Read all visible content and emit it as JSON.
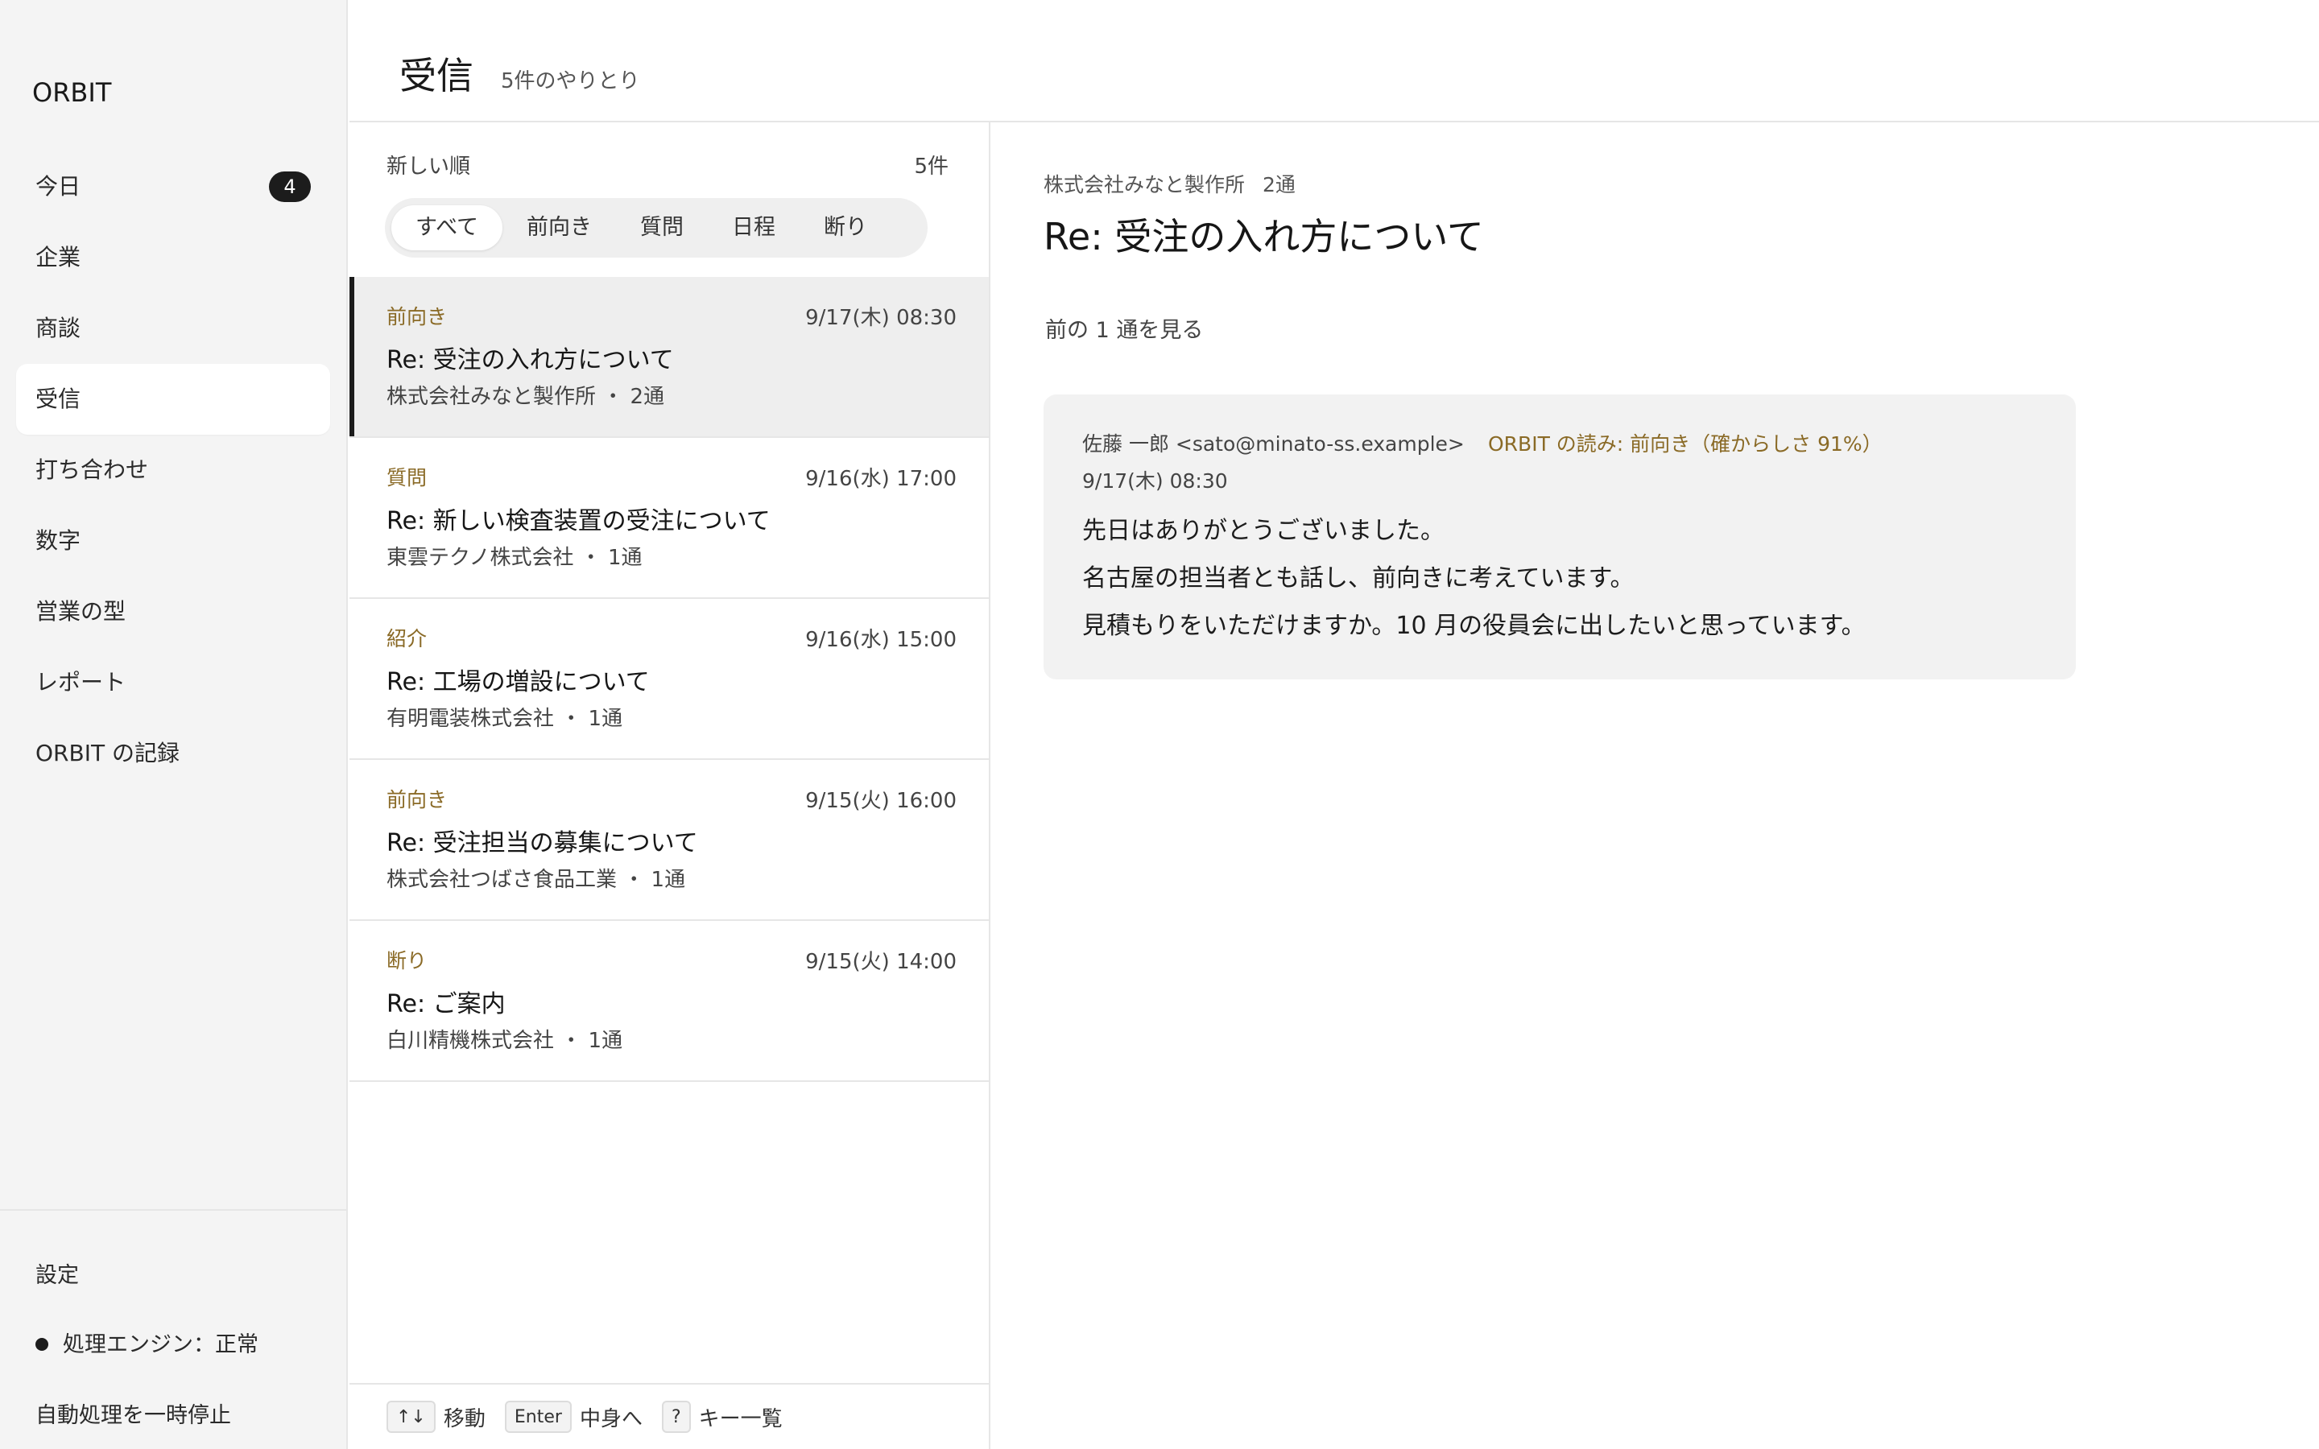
{
  "app": {
    "brand": "ORBIT"
  },
  "sidebar": {
    "items": [
      {
        "label": "今日",
        "badge": "4"
      },
      {
        "label": "企業"
      },
      {
        "label": "商談"
      },
      {
        "label": "受信",
        "active": true
      },
      {
        "label": "打ち合わせ"
      },
      {
        "label": "数字"
      },
      {
        "label": "営業の型"
      },
      {
        "label": "レポート"
      },
      {
        "label": "ORBIT の記録"
      }
    ],
    "settings": "設定",
    "engine_status": "処理エンジン：正常",
    "pause": "自動処理を一時停止"
  },
  "header": {
    "title": "受信",
    "subtitle": "5件のやりとり"
  },
  "list": {
    "sort": "新しい順",
    "count": "5件",
    "filters": [
      "すべて",
      "前向き",
      "質問",
      "日程",
      "断り"
    ],
    "active_filter": "すべて",
    "messages": [
      {
        "tag": "前向き",
        "date": "9/17(木) 08:30",
        "subject": "Re: 受注の入れ方について",
        "sender": "株式会社みなと製作所 ・ 2通",
        "selected": true
      },
      {
        "tag": "質問",
        "date": "9/16(水) 17:00",
        "subject": "Re: 新しい検査装置の受注について",
        "sender": "東雲テクノ株式会社 ・ 1通"
      },
      {
        "tag": "紹介",
        "date": "9/16(水) 15:00",
        "subject": "Re: 工場の増設について",
        "sender": "有明電装株式会社 ・ 1通"
      },
      {
        "tag": "前向き",
        "date": "9/15(火) 16:00",
        "subject": "Re: 受注担当の募集について",
        "sender": "株式会社つばさ食品工業 ・ 1通"
      },
      {
        "tag": "断り",
        "date": "9/15(火) 14:00",
        "subject": "Re: ご案内",
        "sender": "白川精機株式会社 ・ 1通"
      }
    ],
    "footer": {
      "move_key": "↑↓",
      "move_label": "移動",
      "enter_key": "Enter",
      "enter_label": "中身へ",
      "help_key": "?",
      "help_label": "キー一覧"
    }
  },
  "detail": {
    "company": "株式会社みなと製作所",
    "count": "2通",
    "title": "Re: 受注の入れ方について",
    "prev_link": "前の 1 通を見る",
    "message": {
      "from": "佐藤 一郎 <sato@minato-ss.example>",
      "ai_reading": "ORBIT の読み: 前向き（確からしさ 91%）",
      "date": "9/17(木) 08:30",
      "body": [
        "先日はありがとうございました。",
        "名古屋の担当者とも話し、前向きに考えています。",
        "見積もりをいただけますか。10 月の役員会に出したいと思っています。"
      ]
    }
  },
  "colors": {
    "accent_tag": "#8a6a26",
    "selected_row": "#eeeeee",
    "dark": "#1c1c1c"
  }
}
